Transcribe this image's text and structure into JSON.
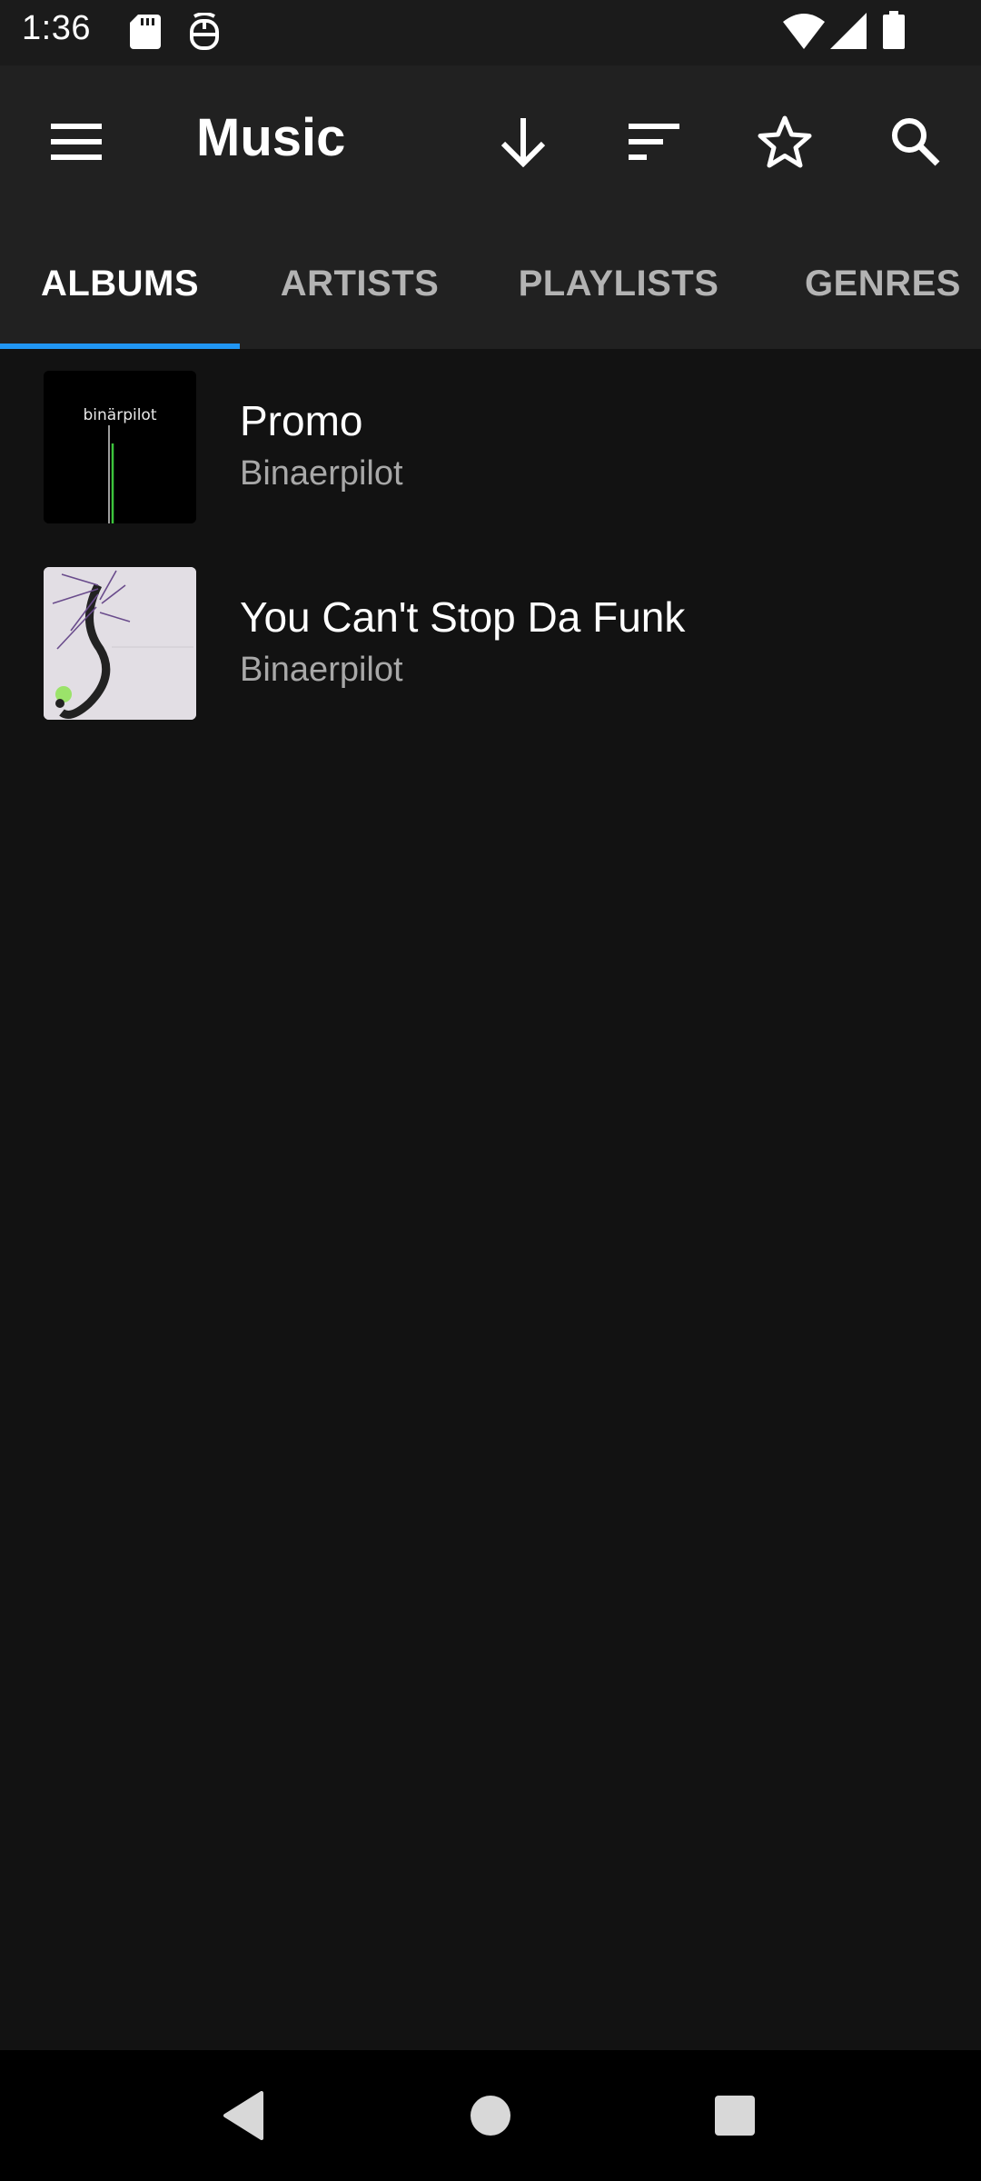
{
  "status_bar": {
    "time": "1:36",
    "icons": [
      "sd-card-icon",
      "notification-app-icon",
      "wifi-icon",
      "cell-signal-icon",
      "battery-icon"
    ]
  },
  "app_bar": {
    "title": "Music",
    "actions": [
      "menu-icon",
      "download-icon",
      "sort-icon",
      "star-icon",
      "search-icon"
    ]
  },
  "tabs": [
    {
      "label": "ALBUMS",
      "active": true
    },
    {
      "label": "ARTISTS",
      "active": false
    },
    {
      "label": "PLAYLISTS",
      "active": false
    },
    {
      "label": "GENRES",
      "active": false
    }
  ],
  "albums": [
    {
      "title": "Promo",
      "artist": "Binaerpilot",
      "cover_text": "binärpilot"
    },
    {
      "title": "You Can't Stop Da Funk",
      "artist": "Binaerpilot"
    }
  ],
  "colors": {
    "background": "#121212",
    "app_bar": "#212121",
    "status_bar": "#1b1b1b",
    "accent": "#2196f3",
    "secondary_text": "#a8a8a8"
  },
  "nav_bar": {
    "buttons": [
      "back-icon",
      "home-icon",
      "recents-icon"
    ]
  }
}
